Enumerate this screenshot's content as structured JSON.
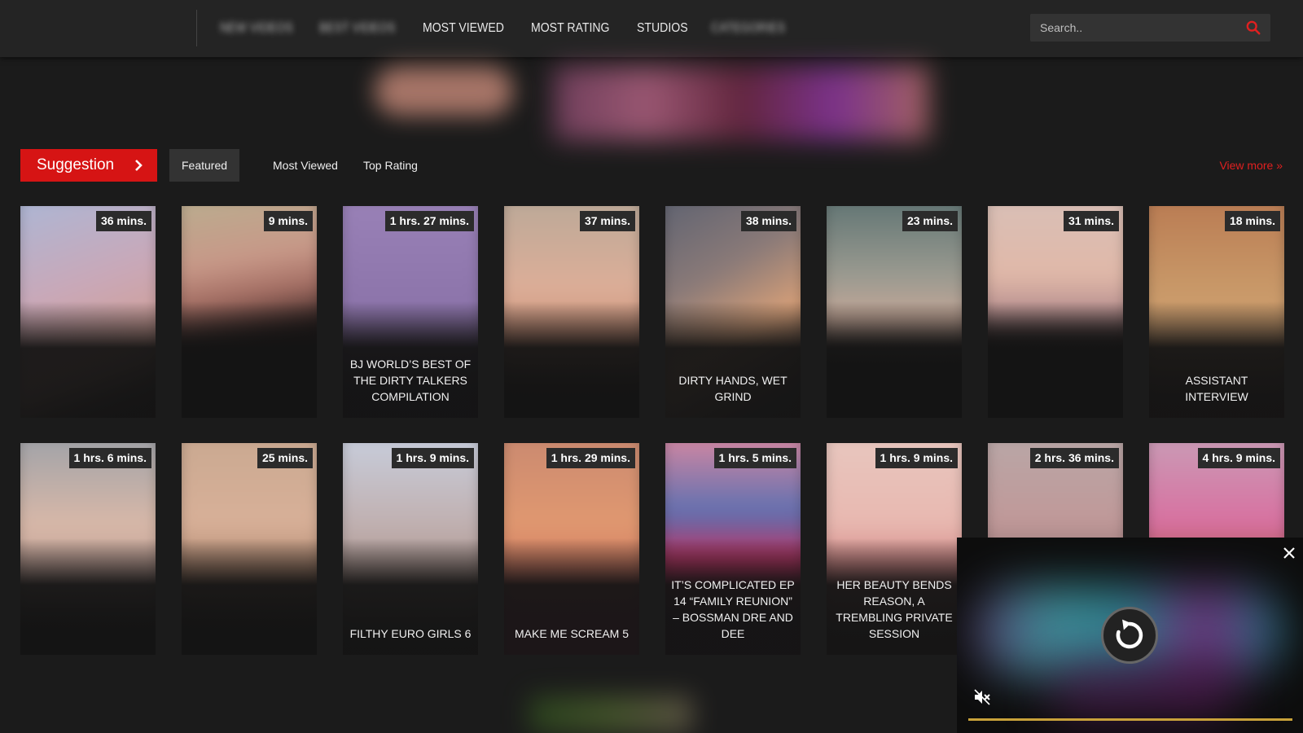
{
  "header": {
    "nav": [
      {
        "label": "NEW VIDEOS",
        "obscured": true
      },
      {
        "label": "BEST VIDEOS",
        "obscured": true
      },
      {
        "label": "MOST VIEWED",
        "obscured": false
      },
      {
        "label": "MOST RATING",
        "obscured": false
      },
      {
        "label": "STUDIOS",
        "obscured": false
      },
      {
        "label": "CATEGORIES",
        "obscured": true
      }
    ],
    "search": {
      "placeholder": "Search..",
      "value": "",
      "icon": "search-icon",
      "icon_color": "#e02020"
    }
  },
  "section": {
    "button_label": "Suggestion",
    "tabs": [
      {
        "label": "Featured",
        "active": true
      },
      {
        "label": "Most Viewed",
        "active": false
      },
      {
        "label": "Top Rating",
        "active": false
      }
    ],
    "view_more": "View more »",
    "accent": "#d61414"
  },
  "row1": [
    {
      "duration": "36 mins.",
      "title": ""
    },
    {
      "duration": "9 mins.",
      "title": ""
    },
    {
      "duration": "1 hrs. 27 mins.",
      "title": "BJ WORLD’S BEST OF THE DIRTY TALKERS COMPILATION"
    },
    {
      "duration": "37 mins.",
      "title": ""
    },
    {
      "duration": "38 mins.",
      "title": "DIRTY HANDS, WET GRIND"
    },
    {
      "duration": "23 mins.",
      "title": ""
    },
    {
      "duration": "31 mins.",
      "title": ""
    },
    {
      "duration": "18 mins.",
      "title": "ASSISTANT INTERVIEW"
    }
  ],
  "row2": [
    {
      "duration": "1 hrs. 6 mins.",
      "title": ""
    },
    {
      "duration": "25 mins.",
      "title": ""
    },
    {
      "duration": "1 hrs. 9 mins.",
      "title": "FILTHY EURO GIRLS 6"
    },
    {
      "duration": "1 hrs. 29 mins.",
      "title": "MAKE ME SCREAM 5"
    },
    {
      "duration": "1 hrs. 5 mins.",
      "title": "IT’S COMPLICATED EP 14 “FAMILY REUNION” – BOSSMAN DRE AND DEE"
    },
    {
      "duration": "1 hrs. 9 mins.",
      "title": "HER BEAUTY BENDS REASON, A TREMBLING PRIVATE SESSION"
    },
    {
      "duration": "2 hrs. 36 mins.",
      "title": ""
    },
    {
      "duration": "4 hrs. 9 mins.",
      "title": ""
    }
  ],
  "player": {
    "close_icon": "close-icon",
    "replay_icon": "replay-icon",
    "mute_icon": "mute-icon",
    "progress": 1.0,
    "progress_color": "#c9a23a"
  }
}
